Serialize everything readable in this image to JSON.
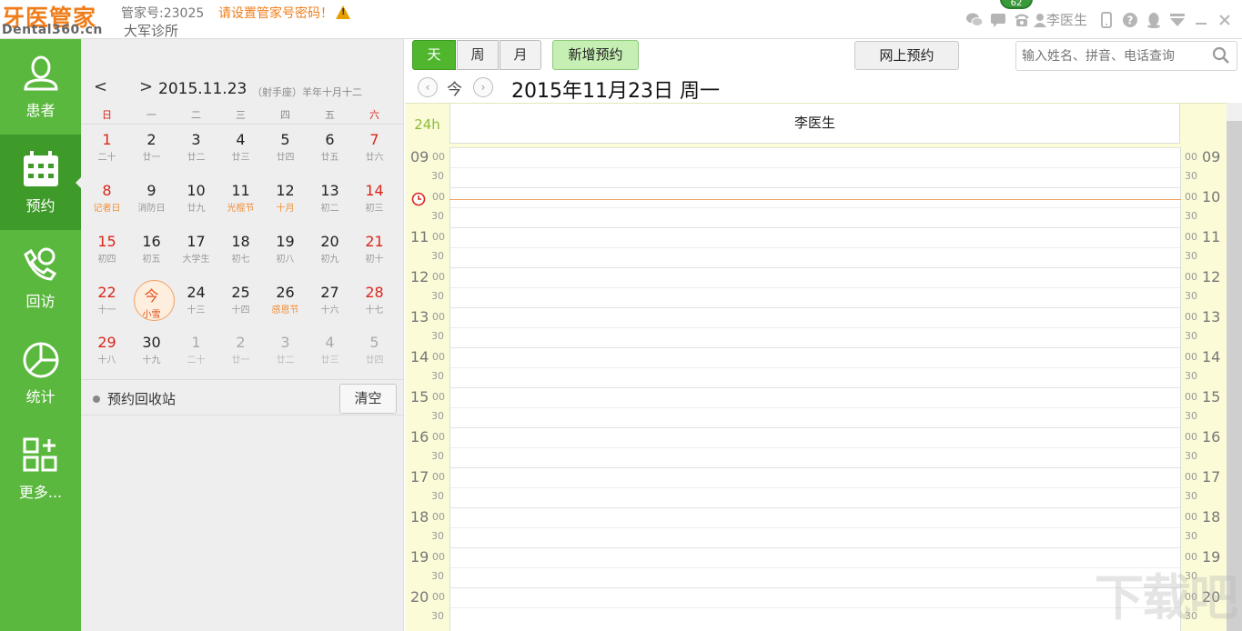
{
  "brand": {
    "name_cn": "牙医管家",
    "name_en": "Dental360.cn"
  },
  "header": {
    "account": "管家号:23025",
    "password_warning": "请设置管家号密码！",
    "clinic": "大军诊所",
    "user": "李医生",
    "badge_count": "62"
  },
  "nav": {
    "items": [
      {
        "label": "患者",
        "icon": "patient-icon"
      },
      {
        "label": "预约",
        "icon": "calendar-icon"
      },
      {
        "label": "回访",
        "icon": "phone-call-icon"
      },
      {
        "label": "统计",
        "icon": "pie-chart-icon"
      },
      {
        "label": "更多...",
        "icon": "grid-add-icon"
      }
    ]
  },
  "calendar": {
    "prev": "<",
    "next": ">",
    "date": "2015.11.23",
    "lunar_info": "（射手座）羊年十月十二",
    "weekdays": [
      "日",
      "一",
      "二",
      "三",
      "四",
      "五",
      "六"
    ],
    "weeks": [
      [
        {
          "d": "1",
          "l": "二十"
        },
        {
          "d": "2",
          "l": "廿一"
        },
        {
          "d": "3",
          "l": "廿二"
        },
        {
          "d": "4",
          "l": "廿三"
        },
        {
          "d": "5",
          "l": "廿四"
        },
        {
          "d": "6",
          "l": "廿五"
        },
        {
          "d": "7",
          "l": "廿六"
        }
      ],
      [
        {
          "d": "8",
          "l": "记者日"
        },
        {
          "d": "9",
          "l": "消防日"
        },
        {
          "d": "10",
          "l": "廿九"
        },
        {
          "d": "11",
          "l": "光棍节"
        },
        {
          "d": "12",
          "l": "十月"
        },
        {
          "d": "13",
          "l": "初二"
        },
        {
          "d": "14",
          "l": "初三"
        }
      ],
      [
        {
          "d": "15",
          "l": "初四"
        },
        {
          "d": "16",
          "l": "初五"
        },
        {
          "d": "17",
          "l": "大学生"
        },
        {
          "d": "18",
          "l": "初七"
        },
        {
          "d": "19",
          "l": "初八"
        },
        {
          "d": "20",
          "l": "初九"
        },
        {
          "d": "21",
          "l": "初十"
        }
      ],
      [
        {
          "d": "22",
          "l": "十一"
        },
        {
          "d": "今",
          "l": "小雪"
        },
        {
          "d": "24",
          "l": "十三"
        },
        {
          "d": "25",
          "l": "十四"
        },
        {
          "d": "26",
          "l": "感恩节"
        },
        {
          "d": "27",
          "l": "十六"
        },
        {
          "d": "28",
          "l": "十七"
        }
      ],
      [
        {
          "d": "29",
          "l": "十八"
        },
        {
          "d": "30",
          "l": "十九"
        },
        {
          "d": "1",
          "l": "二十"
        },
        {
          "d": "2",
          "l": "廿一"
        },
        {
          "d": "3",
          "l": "廿二"
        },
        {
          "d": "4",
          "l": "廿三"
        },
        {
          "d": "5",
          "l": "廿四"
        }
      ]
    ],
    "recycle_label": "预约回收站",
    "clear_label": "清空"
  },
  "toolbar": {
    "view_day": "天",
    "view_week": "周",
    "view_month": "月",
    "new_appointment": "新增预约",
    "online_booking": "网上预约",
    "search_placeholder": "输入姓名、拼音、电话查询"
  },
  "day_view": {
    "today_label": "今",
    "title": "2015年11月23日 周一",
    "all_day_label": "24h",
    "doctor_column": "李医生",
    "hours": [
      "09",
      "10",
      "11",
      "12",
      "13",
      "14",
      "15",
      "16",
      "17",
      "18",
      "19",
      "20"
    ],
    "minute_labels": [
      "00",
      "30"
    ]
  },
  "colors": {
    "brand_orange": "#f07d1a",
    "nav_green": "#5bb83e",
    "nav_active": "#3e9a29",
    "gutter_yellow": "#fbfbd8"
  }
}
